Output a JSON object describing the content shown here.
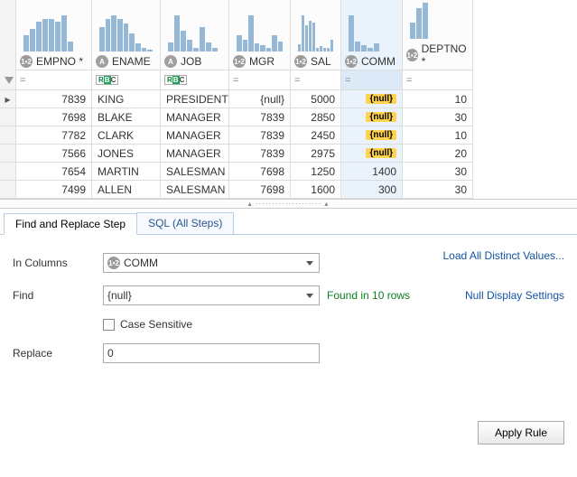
{
  "columns": {
    "empno": {
      "label": "EMPNO *",
      "type": "num"
    },
    "ename": {
      "label": "ENAME",
      "type": "txt"
    },
    "job": {
      "label": "JOB",
      "type": "txt"
    },
    "mgr": {
      "label": "MGR",
      "type": "num"
    },
    "sal": {
      "label": "SAL",
      "type": "num"
    },
    "comm": {
      "label": "COMM",
      "type": "num"
    },
    "deptno": {
      "label": "DEPTNO *",
      "type": "num"
    }
  },
  "filter_ops": {
    "empno": "=",
    "ename": "",
    "job": "",
    "mgr": "=",
    "sal": "=",
    "comm": "=",
    "deptno": "="
  },
  "rows": [
    {
      "empno": "7839",
      "ename": "KING",
      "job": "PRESIDENT",
      "mgr": "{null}",
      "sal": "5000",
      "comm": "{null}",
      "deptno": "10",
      "current": true
    },
    {
      "empno": "7698",
      "ename": "BLAKE",
      "job": "MANAGER",
      "mgr": "7839",
      "sal": "2850",
      "comm": "{null}",
      "deptno": "30"
    },
    {
      "empno": "7782",
      "ename": "CLARK",
      "job": "MANAGER",
      "mgr": "7839",
      "sal": "2450",
      "comm": "{null}",
      "deptno": "10"
    },
    {
      "empno": "7566",
      "ename": "JONES",
      "job": "MANAGER",
      "mgr": "7839",
      "sal": "2975",
      "comm": "{null}",
      "deptno": "20"
    },
    {
      "empno": "7654",
      "ename": "MARTIN",
      "job": "SALESMAN",
      "mgr": "7698",
      "sal": "1250",
      "comm": "1400",
      "deptno": "30"
    },
    {
      "empno": "7499",
      "ename": "ALLEN",
      "job": "SALESMAN",
      "mgr": "7698",
      "sal": "1600",
      "comm": "300",
      "deptno": "30"
    }
  ],
  "tabs": {
    "find_replace": "Find and Replace Step",
    "sql": "SQL (All Steps)"
  },
  "form": {
    "in_columns_label": "In Columns",
    "in_columns_value": "COMM",
    "find_label": "Find",
    "find_value": "{null}",
    "found_msg": "Found in 10 rows",
    "case_sensitive_label": "Case Sensitive",
    "replace_label": "Replace",
    "replace_value": "0",
    "load_distinct": "Load All Distinct Values...",
    "null_settings": "Null Display Settings",
    "apply": "Apply Rule"
  },
  "chart_data": [
    {
      "type": "bar",
      "column": "EMPNO",
      "values": [
        10,
        14,
        18,
        20,
        20,
        18,
        22,
        6
      ]
    },
    {
      "type": "bar",
      "column": "ENAME",
      "values": [
        30,
        40,
        44,
        40,
        34,
        22,
        10,
        4,
        2
      ]
    },
    {
      "type": "bar",
      "column": "JOB",
      "values": [
        10,
        42,
        24,
        14,
        4,
        28,
        10,
        4
      ]
    },
    {
      "type": "bar",
      "column": "MGR",
      "values": [
        20,
        14,
        44,
        10,
        8,
        4,
        20,
        12
      ]
    },
    {
      "type": "bar",
      "column": "SAL",
      "values": [
        8,
        42,
        30,
        36,
        34,
        4,
        6,
        4,
        4,
        14
      ]
    },
    {
      "type": "bar",
      "column": "COMM",
      "values": [
        44,
        12,
        8,
        4,
        10
      ]
    },
    {
      "type": "bar",
      "column": "DEPTNO",
      "values": [
        18,
        34,
        40
      ]
    }
  ],
  "icons": {
    "num": "1•2",
    "txt": "A"
  }
}
